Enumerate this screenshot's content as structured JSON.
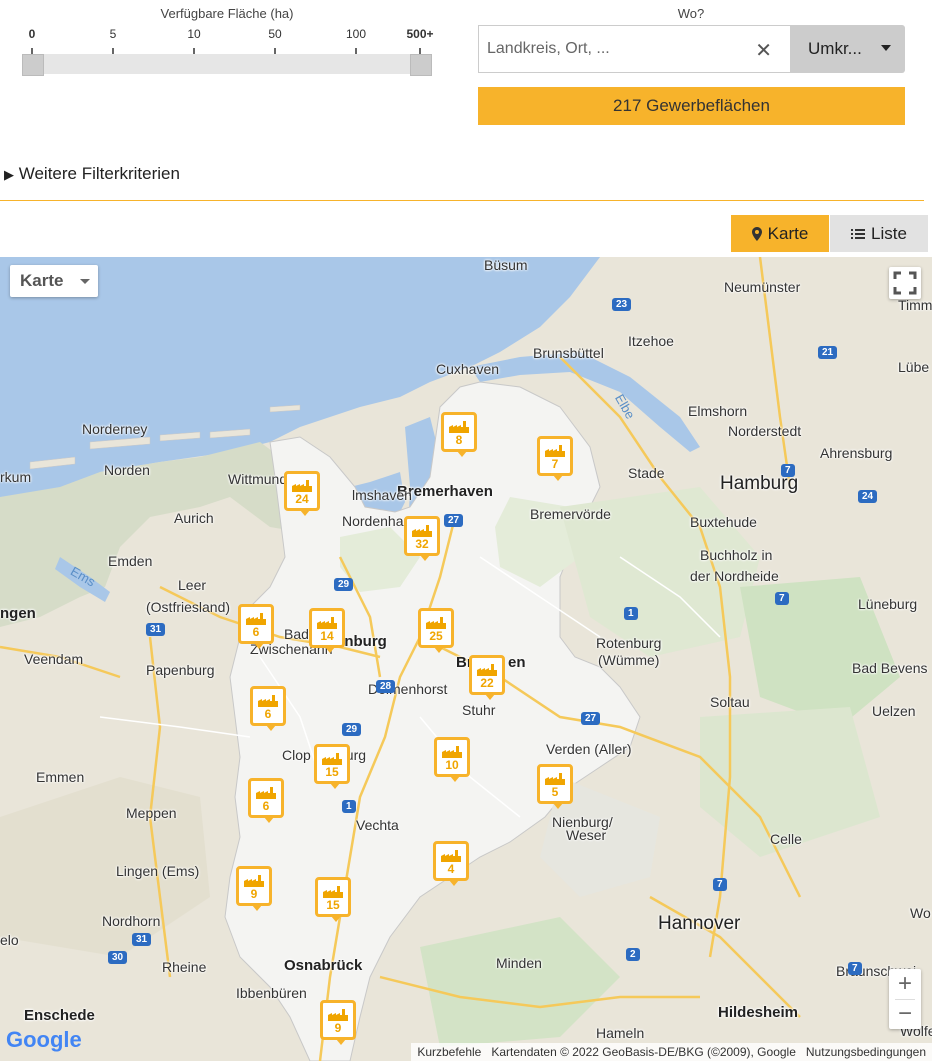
{
  "filter": {
    "area_title": "Verfügbare Fläche (ha)",
    "ticks": [
      {
        "label": "0",
        "bold": true
      },
      {
        "label": "5",
        "bold": false
      },
      {
        "label": "10",
        "bold": false
      },
      {
        "label": "50",
        "bold": false
      },
      {
        "label": "100",
        "bold": false
      },
      {
        "label": "500+",
        "bold": true
      }
    ],
    "range_min": "0",
    "range_max": "500+",
    "more_filters": "Weitere Filterkriterien"
  },
  "search": {
    "wo_label": "Wo?",
    "placeholder": "Landkreis, Ort, ...",
    "value": "",
    "clear_icon": "close-icon",
    "radius_label": "Umkr...",
    "result_button": "217 Gewerbeflächen"
  },
  "view_toggle": {
    "map_label": "Karte",
    "map_icon": "pin-icon",
    "list_label": "Liste",
    "list_icon": "list-icon",
    "active": "Karte"
  },
  "map": {
    "maptype_label": "Karte",
    "places": [
      {
        "name": "Büsum",
        "cls": ""
      },
      {
        "name": "Neumünster",
        "cls": ""
      },
      {
        "name": "Timm",
        "cls": ""
      },
      {
        "name": "Itzehoe",
        "cls": ""
      },
      {
        "name": "Brunsbüttel",
        "cls": ""
      },
      {
        "name": "Lübe",
        "cls": ""
      },
      {
        "name": "Cuxhaven",
        "cls": ""
      },
      {
        "name": "Elmshorn",
        "cls": ""
      },
      {
        "name": "Norderstedt",
        "cls": ""
      },
      {
        "name": "Ahrensburg",
        "cls": ""
      },
      {
        "name": "Norderney",
        "cls": ""
      },
      {
        "name": "Norden",
        "cls": ""
      },
      {
        "name": "rkum",
        "cls": ""
      },
      {
        "name": "Wittmund",
        "cls": ""
      },
      {
        "name": "Bremerhaven",
        "cls": "bold"
      },
      {
        "name": "Stade",
        "cls": ""
      },
      {
        "name": "Hamburg",
        "cls": "big"
      },
      {
        "name": "Aurich",
        "cls": ""
      },
      {
        "name": "lmshaven",
        "cls": ""
      },
      {
        "name": "Nordenham",
        "cls": ""
      },
      {
        "name": "Bremervörde",
        "cls": ""
      },
      {
        "name": "Buxtehude",
        "cls": ""
      },
      {
        "name": "Emden",
        "cls": ""
      },
      {
        "name": "Buchholz in",
        "cls": ""
      },
      {
        "name": "der Nordheide",
        "cls": ""
      },
      {
        "name": "Leer",
        "cls": ""
      },
      {
        "name": "(Ostfriesland)",
        "cls": ""
      },
      {
        "name": "Lüneburg",
        "cls": ""
      },
      {
        "name": "ngen",
        "cls": "bold"
      },
      {
        "name": "Bad",
        "cls": ""
      },
      {
        "name": "Zwischenahn",
        "cls": ""
      },
      {
        "name": "enburg",
        "cls": "bold"
      },
      {
        "name": "Rotenburg",
        "cls": ""
      },
      {
        "name": "(Wümme)",
        "cls": ""
      },
      {
        "name": "Veendam",
        "cls": ""
      },
      {
        "name": "Papenburg",
        "cls": ""
      },
      {
        "name": "Br",
        "cls": "bold"
      },
      {
        "name": "en",
        "cls": "bold"
      },
      {
        "name": "Bad Bevens",
        "cls": ""
      },
      {
        "name": "Delmenhorst",
        "cls": ""
      },
      {
        "name": "Soltau",
        "cls": ""
      },
      {
        "name": "Stuhr",
        "cls": ""
      },
      {
        "name": "Uelzen",
        "cls": ""
      },
      {
        "name": "Clop",
        "cls": ""
      },
      {
        "name": "burg",
        "cls": ""
      },
      {
        "name": "Verden (Aller)",
        "cls": ""
      },
      {
        "name": "Emmen",
        "cls": ""
      },
      {
        "name": "Meppen",
        "cls": ""
      },
      {
        "name": "Vechta",
        "cls": ""
      },
      {
        "name": "Nienburg/",
        "cls": ""
      },
      {
        "name": "Weser",
        "cls": ""
      },
      {
        "name": "Celle",
        "cls": ""
      },
      {
        "name": "Lingen (Ems)",
        "cls": ""
      },
      {
        "name": "Nordhorn",
        "cls": ""
      },
      {
        "name": "Hannover",
        "cls": "big"
      },
      {
        "name": "Wo",
        "cls": ""
      },
      {
        "name": "elo",
        "cls": ""
      },
      {
        "name": "Rheine",
        "cls": ""
      },
      {
        "name": "Osnabrück",
        "cls": "bold"
      },
      {
        "name": "Minden",
        "cls": ""
      },
      {
        "name": "Braunschwei",
        "cls": ""
      },
      {
        "name": "Ibbenbüren",
        "cls": ""
      },
      {
        "name": "Enschede",
        "cls": "bold"
      },
      {
        "name": "Hildesheim",
        "cls": "bold"
      },
      {
        "name": "Wolfe",
        "cls": ""
      },
      {
        "name": "Hameln",
        "cls": ""
      },
      {
        "name": "Ems",
        "cls": "water"
      },
      {
        "name": "Elbe",
        "cls": "water"
      }
    ],
    "highways": [
      {
        "label": "23",
        "type": "a"
      },
      {
        "label": "21",
        "type": "a"
      },
      {
        "label": "7",
        "type": "a"
      },
      {
        "label": "24",
        "type": "a"
      },
      {
        "label": "27",
        "type": "a"
      },
      {
        "label": "29",
        "type": "a"
      },
      {
        "label": "1",
        "type": "a"
      },
      {
        "label": "7",
        "type": "a"
      },
      {
        "label": "31",
        "type": "a"
      },
      {
        "label": "28",
        "type": "a"
      },
      {
        "label": "29",
        "type": "a"
      },
      {
        "label": "27",
        "type": "a"
      },
      {
        "label": "1",
        "type": "a"
      },
      {
        "label": "7",
        "type": "a"
      },
      {
        "label": "31",
        "type": "a"
      },
      {
        "label": "2",
        "type": "a"
      },
      {
        "label": "30",
        "type": "a"
      },
      {
        "label": "7",
        "type": "a"
      }
    ],
    "markers": [
      "8",
      "7",
      "24",
      "32",
      "6",
      "14",
      "25",
      "22",
      "6",
      "15",
      "10",
      "5",
      "6",
      "4",
      "9",
      "15",
      "9"
    ],
    "google_logo": "Google",
    "attribution": {
      "shortcuts": "Kurzbefehle",
      "data": "Kartendaten © 2022 GeoBasis-DE/BKG (©2009), Google",
      "terms": "Nutzungsbedingungen"
    }
  }
}
